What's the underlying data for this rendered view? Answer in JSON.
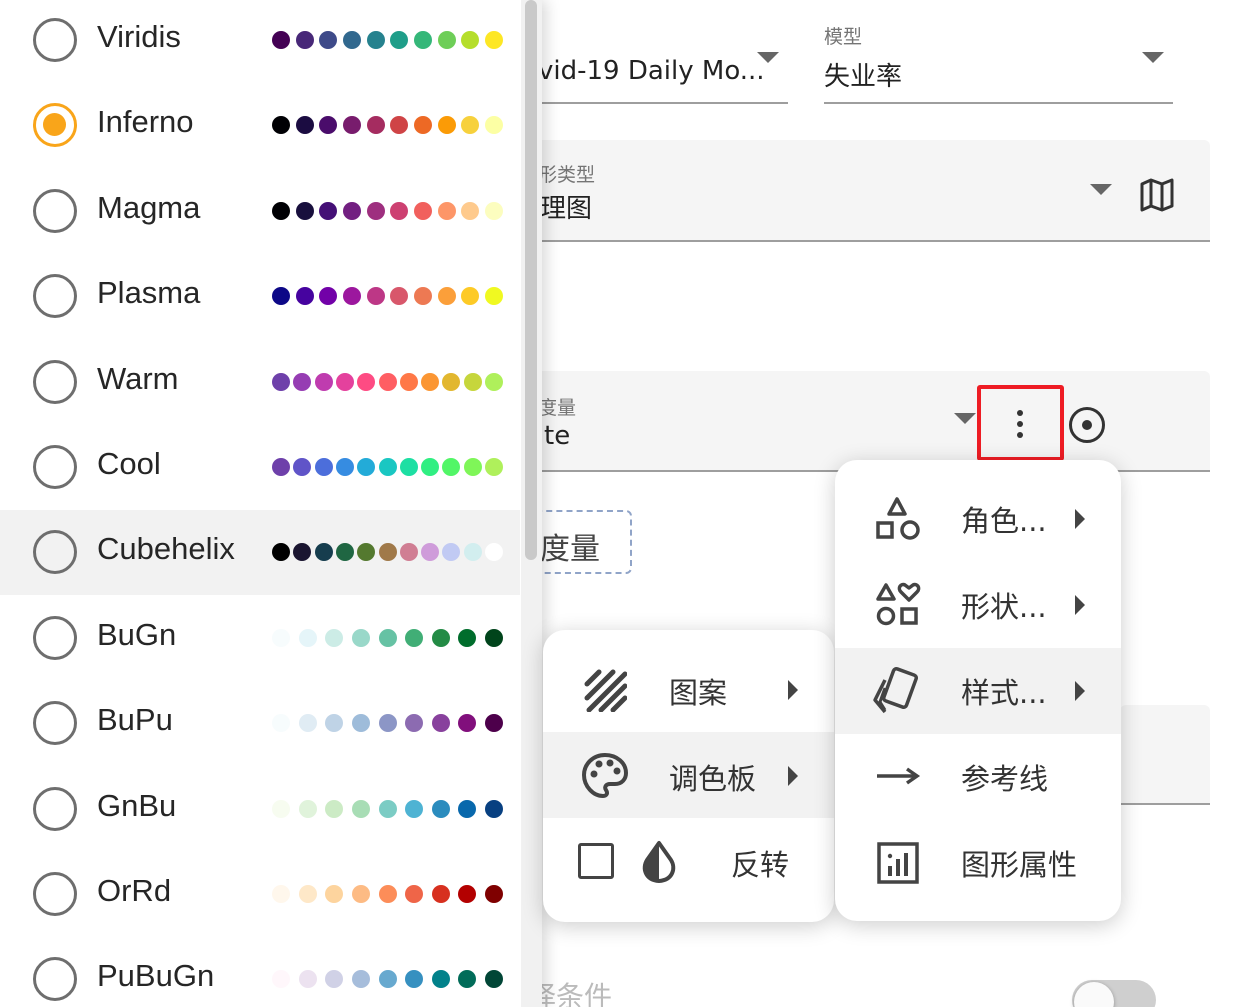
{
  "background": {
    "dataset_field": {
      "value": "vid-19 Daily Mo..."
    },
    "model_field": {
      "label": "模型",
      "value": "失业率"
    },
    "chart_type_field": {
      "label": "形类型",
      "value": "理图",
      "icon": "map-icon"
    },
    "measure_field": {
      "label": "度量",
      "value": "te"
    },
    "add_measure_chip": "度量",
    "filter_label": "择条件"
  },
  "palette_list": {
    "selected": "Inferno",
    "hovered": "Cubehelix",
    "items": [
      {
        "name": "Viridis",
        "colors": [
          "#440154",
          "#482878",
          "#3e4a89",
          "#31688e",
          "#26828e",
          "#1f9e89",
          "#35b779",
          "#6ece58",
          "#b5de2b",
          "#fde725"
        ]
      },
      {
        "name": "Inferno",
        "colors": [
          "#000004",
          "#1b0c41",
          "#4a0c6b",
          "#781c6d",
          "#a52c60",
          "#cf4446",
          "#ed6925",
          "#fb9b06",
          "#f7d13d",
          "#fcffa4"
        ]
      },
      {
        "name": "Magma",
        "colors": [
          "#000004",
          "#180f3d",
          "#440f76",
          "#721f81",
          "#9e2f7f",
          "#cd4071",
          "#f1605d",
          "#fd9668",
          "#feca8d",
          "#fcfdbf"
        ]
      },
      {
        "name": "Plasma",
        "colors": [
          "#0d0887",
          "#46039f",
          "#7201a8",
          "#9c179e",
          "#bd3786",
          "#d8576b",
          "#ed7953",
          "#fb9f3a",
          "#fdca26",
          "#f0f921"
        ]
      },
      {
        "name": "Warm",
        "colors": [
          "#6e40aa",
          "#963db3",
          "#bf3caf",
          "#e4419d",
          "#fe4b83",
          "#ff5e63",
          "#ff7847",
          "#fb9633",
          "#e2b72f",
          "#c6d63c",
          "#aff05b"
        ]
      },
      {
        "name": "Cool",
        "colors": [
          "#6e40aa",
          "#6054c8",
          "#4c6edb",
          "#368ce1",
          "#23abd8",
          "#1ac7c2",
          "#1ddfa3",
          "#30ef82",
          "#52f667",
          "#7ff658",
          "#aff05b"
        ]
      },
      {
        "name": "Cubehelix",
        "colors": [
          "#000000",
          "#1a1530",
          "#163d4e",
          "#1f6642",
          "#54792f",
          "#a07949",
          "#d07e93",
          "#cf9cda",
          "#c1caf3",
          "#d2eeef",
          "#ffffff"
        ]
      },
      {
        "name": "BuGn",
        "colors": [
          "#f7fcfd",
          "#e5f5f9",
          "#ccece6",
          "#99d8c9",
          "#66c2a4",
          "#41ae76",
          "#238b45",
          "#006d2c",
          "#00441b"
        ]
      },
      {
        "name": "BuPu",
        "colors": [
          "#f7fcfd",
          "#e0ecf4",
          "#bfd3e6",
          "#9ebcda",
          "#8c96c6",
          "#8c6bb1",
          "#88419d",
          "#810f7c",
          "#4d004b"
        ]
      },
      {
        "name": "GnBu",
        "colors": [
          "#f7fcf0",
          "#e0f3db",
          "#ccebc5",
          "#a8ddb5",
          "#7bccc4",
          "#4eb3d3",
          "#2b8cbe",
          "#0868ac",
          "#084081"
        ]
      },
      {
        "name": "OrRd",
        "colors": [
          "#fff7ec",
          "#fee8c8",
          "#fdd49e",
          "#fdbb84",
          "#fc8d59",
          "#ef6548",
          "#d7301f",
          "#b30000",
          "#7f0000"
        ]
      },
      {
        "name": "PuBuGn",
        "colors": [
          "#fff7fb",
          "#ece2f0",
          "#d0d1e6",
          "#a6bddb",
          "#67a9cf",
          "#3690c0",
          "#02818a",
          "#016c59",
          "#014636"
        ]
      }
    ]
  },
  "context_menu": {
    "items": [
      {
        "label": "角色...",
        "icon": "roles-shapes-icon",
        "submenu": true
      },
      {
        "label": "形状...",
        "icon": "shapes-heart-icon",
        "submenu": true
      },
      {
        "label": "样式...",
        "icon": "style-cards-icon",
        "submenu": true
      },
      {
        "label": "参考线",
        "icon": "arrow-right-icon",
        "submenu": false
      },
      {
        "label": "图形属性",
        "icon": "chart-properties-icon",
        "submenu": false
      }
    ]
  },
  "style_submenu": {
    "pattern_label": "图案",
    "palette_label": "调色板",
    "reverse_label": "反转",
    "reverse_checked": false
  }
}
